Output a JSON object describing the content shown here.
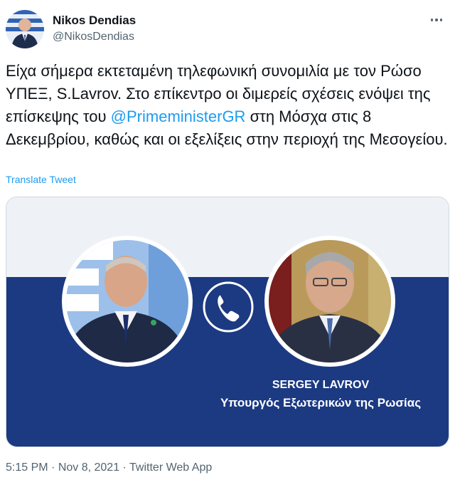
{
  "author": {
    "display_name": "Nikos Dendias",
    "handle": "@NikosDendias",
    "avatar_icon": "person-avatar"
  },
  "more_icon": "more-horizontal-icon",
  "tweet": {
    "text_before": "Είχα σήμερα εκτεταμένη τηλεφωνική συνομιλία με τον Ρώσο ΥΠΕΞ, S.Lavrov. Στο επίκεντρο οι διμερείς σχέσεις ενόψει της επίσκεψης του ",
    "mention": "@PrimeministerGR",
    "text_after": " στη Μόσχα στις 8 Δεκεμβρίου, καθώς και οι εξελίξεις στην περιοχή της Μεσογείου.",
    "translate_label": "Translate Tweet"
  },
  "media": {
    "caption_name": "SERGEY LAVROV",
    "caption_title": "Υπουργός Εξωτερικών της Ρωσίας",
    "phone_icon": "phone-icon",
    "colors": {
      "navy": "#1c3a82",
      "light": "#eff3f8"
    }
  },
  "footer": {
    "time": "5:15 PM",
    "date": "Nov 8, 2021",
    "source": "Twitter Web App",
    "separator": " · "
  }
}
